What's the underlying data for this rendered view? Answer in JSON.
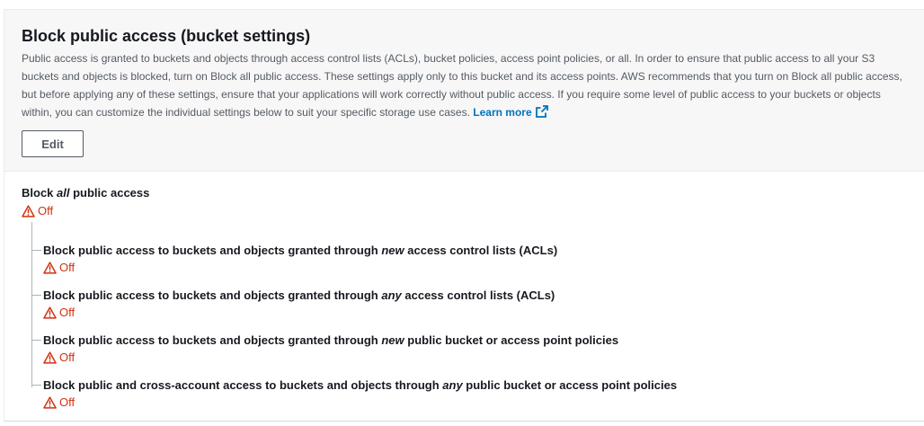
{
  "header": {
    "title": "Block public access (bucket settings)",
    "description": "Public access is granted to buckets and objects through access control lists (ACLs), bucket policies, access point policies, or all. In order to ensure that public access to all your S3 buckets and objects is blocked, turn on Block all public access. These settings apply only to this bucket and its access points. AWS recommends that you turn on Block all public access, but before applying any of these settings, ensure that your applications will work correctly without public access. If you require some level of public access to your buckets or objects within, you can customize the individual settings below to suit your specific storage use cases.",
    "learn_more": "Learn more",
    "edit_label": "Edit"
  },
  "root": {
    "label_prefix": "Block ",
    "label_em": "all",
    "label_suffix": " public access",
    "status": "Off"
  },
  "items": [
    {
      "prefix": "Block public access to buckets and objects granted through ",
      "em": "new",
      "suffix": " access control lists (ACLs)",
      "status": "Off"
    },
    {
      "prefix": "Block public access to buckets and objects granted through ",
      "em": "any",
      "suffix": " access control lists (ACLs)",
      "status": "Off"
    },
    {
      "prefix": "Block public access to buckets and objects granted through ",
      "em": "new",
      "suffix": " public bucket or access point policies",
      "status": "Off"
    },
    {
      "prefix": "Block public and cross-account access to buckets and objects through ",
      "em": "any",
      "suffix": " public bucket or access point policies",
      "status": "Off"
    }
  ],
  "colors": {
    "warning": "#d13212",
    "link": "#0073bb"
  },
  "icons": {
    "warning": "warning-icon",
    "external": "external-link-icon"
  }
}
